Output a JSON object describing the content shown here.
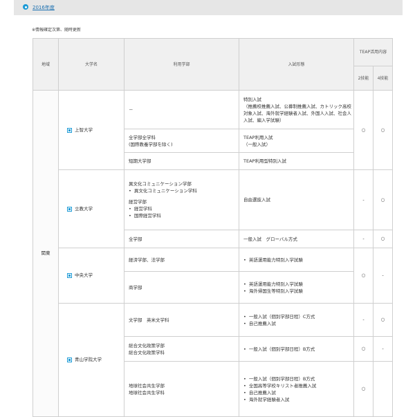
{
  "header": {
    "year_link": "2016年度"
  },
  "note": "※情報確定次第、随時更新",
  "table": {
    "headers": {
      "region": "地域",
      "university": "大学名",
      "faculty": "利用学部",
      "exam_type": "入試形態",
      "teap_content": "TEAP活用内容",
      "two_skill": "2技能",
      "four_skill": "4技能"
    },
    "region_kanto": "関東",
    "sophia": {
      "name": "上智大学",
      "row1_faculty": "－",
      "row1_exam": [
        "特別入試",
        "（推薦校推薦入試、公募制推薦入試、カトリック高校対象入試、海外就学経験者入試、外国人入試、社会人入試、編入学試験）"
      ],
      "row2_faculty": [
        "全学部全学科",
        "(国際教養学部を除く)"
      ],
      "row2_exam": [
        "TEAP利用入試",
        "（一般入試）"
      ],
      "row3_faculty": "短期大学部",
      "row3_exam": "TEAP利用型特別入試",
      "two": "○",
      "four": "○"
    },
    "rikkyo": {
      "name": "立教大学",
      "row1_faculty_a": "異文化コミュニケーション学部",
      "row1_faculty_a_items": [
        "異文化コミュニケーション学科"
      ],
      "row1_faculty_b": "経営学部",
      "row1_faculty_b_items": [
        "経営学科",
        "国際経営学科"
      ],
      "row1_exam": "自由選抜入試",
      "row1_two": "-",
      "row1_four": "○",
      "row2_faculty": "全学部",
      "row2_exam": "一般入試　グローバル方式",
      "row2_two": "-",
      "row2_four": "○"
    },
    "chuo": {
      "name": "中央大学",
      "row1_faculty": "経済学部、法学部",
      "row1_exam_items": [
        "英語運用能力特別入学試験"
      ],
      "row2_faculty": "商学部",
      "row2_exam_items": [
        "英語運用能力特別入学試験",
        "海外帰国生等特別入学試験"
      ],
      "two": "○",
      "four": "-"
    },
    "aoyama": {
      "name": "青山学院大学",
      "row1_faculty": "文学部　英米文学科",
      "row1_exam_items": [
        "一般入試（個別学部日程）C方式",
        "自己推薦入試"
      ],
      "row1_two": "-",
      "row1_four": "○",
      "row2_faculty": [
        "総合文化政策学部",
        "総合文化政策学科"
      ],
      "row2_exam_items": [
        "一般入試（個別学部日程）B方式"
      ],
      "row2_two": "○",
      "row2_four": "-",
      "row3_faculty": [
        "地球社会共生学部",
        "地球社会共生学科"
      ],
      "row3_exam_items": [
        "一般入試（個別学部日程）B方式",
        "全国高等学校キリスト者推薦入試",
        "自己推薦入試",
        "海外就学経験者入試"
      ],
      "row3_two": "○",
      "row3_four": ""
    }
  }
}
